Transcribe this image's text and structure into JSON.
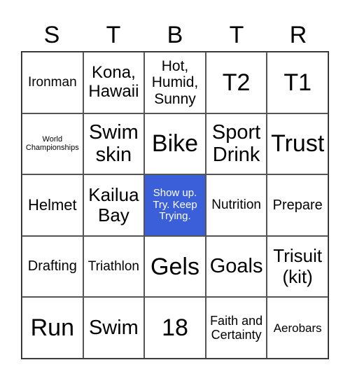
{
  "header": [
    "S",
    "T",
    "B",
    "T",
    "R"
  ],
  "free_color": "#3a5fd8",
  "cells": [
    "Ironman",
    "Kona, Hawaii",
    "Hot, Humid, Sunny",
    "T2",
    "T1",
    "World Championships",
    "Swim skin",
    "Bike",
    "Sport Drink",
    "Trust",
    "Helmet",
    "Kailua Bay",
    "Show up. Try. Keep Trying.",
    "Nutrition",
    "Prepare",
    "Drafting",
    "Triathlon",
    "Gels",
    "Goals",
    "Trisuit (kit)",
    "Run",
    "Swim",
    "18",
    "Faith and Certainty",
    "Aerobars"
  ]
}
